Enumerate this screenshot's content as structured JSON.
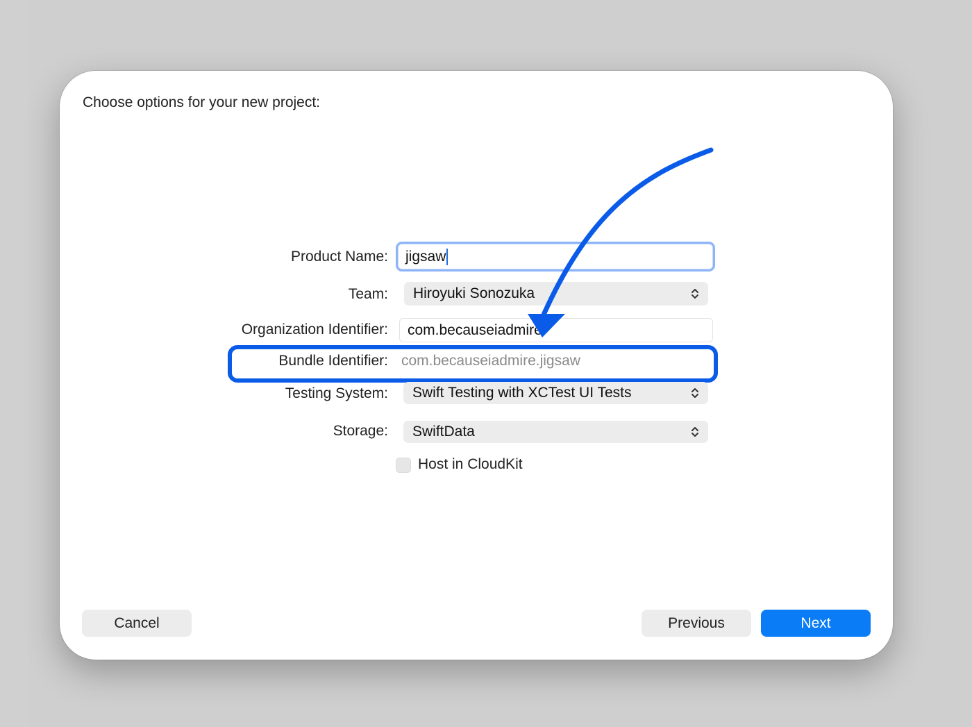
{
  "dialog": {
    "title": "Choose options for your new project:"
  },
  "form": {
    "product_name": {
      "label": "Product Name:",
      "value": "jigsaw"
    },
    "team": {
      "label": "Team:",
      "value": "Hiroyuki Sonozuka"
    },
    "organization_identifier": {
      "label": "Organization Identifier:",
      "value": "com.becauseiadmire"
    },
    "bundle_identifier": {
      "label": "Bundle Identifier:",
      "value": "com.becauseiadmire.jigsaw"
    },
    "testing_system": {
      "label": "Testing System:",
      "value": "Swift Testing with XCTest UI Tests"
    },
    "storage": {
      "label": "Storage:",
      "value": "SwiftData"
    },
    "host_in_cloudkit": {
      "label": "Host in CloudKit",
      "checked": false
    }
  },
  "buttons": {
    "cancel": "Cancel",
    "previous": "Previous",
    "next": "Next"
  },
  "icons": {
    "popup_indicator": "chevron-up-down-icon",
    "annotation_arrow": "curved-arrow-icon"
  },
  "colors": {
    "accent": "#0a7cf6",
    "annotation": "#0a5ce8",
    "focus_ring": "#8db4f6"
  }
}
